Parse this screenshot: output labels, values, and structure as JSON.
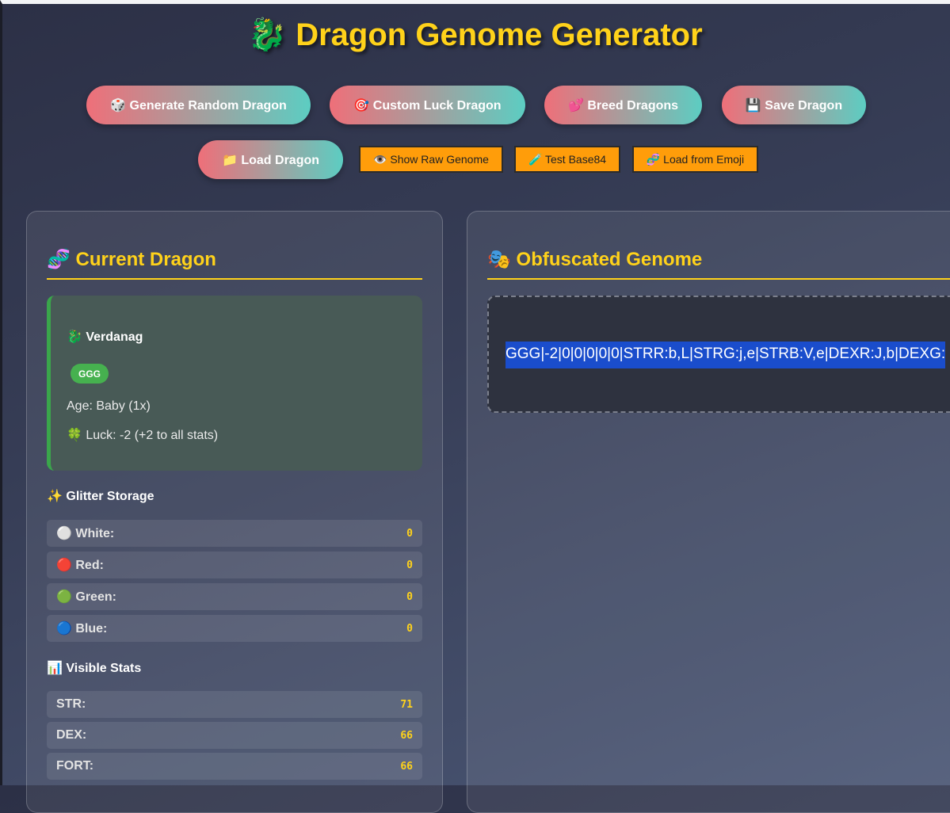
{
  "title": "🐉 Dragon Genome Generator",
  "buttons_primary": [
    {
      "label": "🎲 Generate Random Dragon"
    },
    {
      "label": "🎯 Custom Luck Dragon"
    },
    {
      "label": "💕 Breed Dragons"
    },
    {
      "label": "💾 Save Dragon"
    },
    {
      "label": "📁 Load Dragon"
    }
  ],
  "buttons_secondary": [
    {
      "label": "👁️ Show Raw Genome"
    },
    {
      "label": "🧪 Test Base84"
    },
    {
      "label": "🧬 Load from Emoji"
    }
  ],
  "current_dragon": {
    "heading": "🧬 Current Dragon",
    "name": "🐉 Verdanag",
    "badge": "GGG",
    "age": "Age: Baby (1x)",
    "luck": "🍀 Luck: -2 (+2 to all stats)"
  },
  "glitter": {
    "heading": "✨ Glitter Storage",
    "rows": [
      {
        "label": "⚪ White:",
        "value": "0"
      },
      {
        "label": "🔴 Red:",
        "value": "0"
      },
      {
        "label": "🟢 Green:",
        "value": "0"
      },
      {
        "label": "🔵 Blue:",
        "value": "0"
      }
    ]
  },
  "stats": {
    "heading": "📊 Visible Stats",
    "rows": [
      {
        "label": "STR:",
        "value": "71"
      },
      {
        "label": "DEX:",
        "value": "66"
      },
      {
        "label": "FORT:",
        "value": "66"
      }
    ]
  },
  "obfuscated": {
    "heading": "🎭 Obfuscated Genome",
    "genome": "GGG|-2|0|0|0|0|0|STRR:b,L|STRG:j,e|STRB:V,e|DEXR:J,b|DEXG:"
  },
  "colors": {
    "accent": "#ffd21a",
    "button_gradient_start": "#ef6f79",
    "button_gradient_end": "#5ccdc2",
    "secondary_button": "#ff9d0a",
    "badge_green": "#46b14f",
    "selection_blue": "#1a4dcc"
  }
}
